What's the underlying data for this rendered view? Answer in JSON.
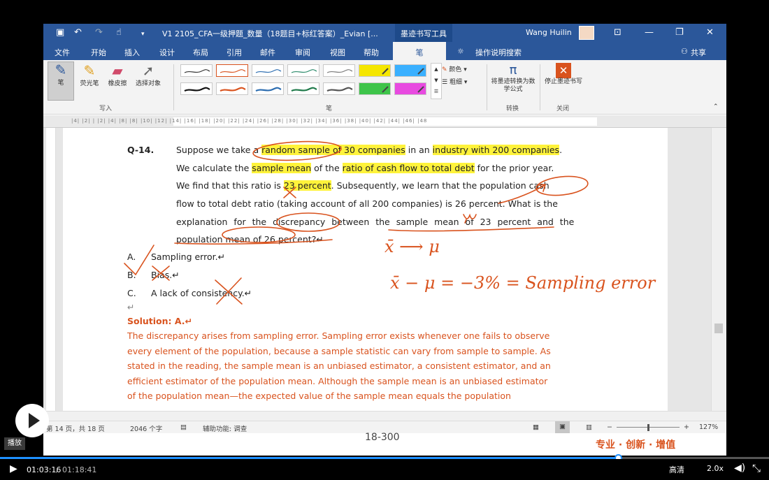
{
  "titlebar": {
    "title": "V1 2105_CFA一级押题_数量（18题目+标红答案）_Evian [...",
    "context_tab": "墨迹书写工具",
    "user": "Wang Huilin"
  },
  "menu": {
    "items": [
      "文件",
      "开始",
      "插入",
      "设计",
      "布局",
      "引用",
      "邮件",
      "审阅",
      "视图",
      "帮助",
      "笔",
      "操作说明搜索"
    ],
    "share": "共享"
  },
  "ribbon": {
    "tools": [
      "笔",
      "荧光笔",
      "橡皮擦",
      "选择对象"
    ],
    "group_write": "写入",
    "group_pens": "笔",
    "color": "颜色",
    "thickness": "粗细",
    "convert": "将墨迹转换为数学公式",
    "stop": "停止墨迹书写",
    "group_convert": "转换",
    "group_close": "关闭"
  },
  "ruler": {
    "numbers": "|4| |2| |  |2| |4| |8| |8| |10| |12| |14| |16| |18| |20| |22| |24| |26| |28| |30| |32| |34| |36| |38| |40| |42| |44| |46| |48"
  },
  "question": {
    "number": "Q-14.",
    "l1_a": "Suppose we take a ",
    "l1_b": "random sample of 30 companies",
    "l1_c": " in an ",
    "l1_d": "industry with 200 companies",
    "l1_e": ".",
    "l2_a": "We calculate the ",
    "l2_b": "sample mean",
    "l2_c": " of the ",
    "l2_d": "ratio of cash flow to total debt",
    "l2_e": " for the prior year.",
    "l3_a": "We find that this ratio is ",
    "l3_b": "23 percent",
    "l3_c": ". Subsequently, we learn that the population cash",
    "l4": "flow to total debt ratio (taking account of all 200 companies) is 26 percent. What is the",
    "l5": "explanation for the discrepancy between the sample mean of 23 percent and the",
    "l6": "population mean of 26 percent?↵"
  },
  "options": [
    {
      "letter": "A.",
      "text": "Sampling error.↵"
    },
    {
      "letter": "B.",
      "text": "Bias.↵"
    },
    {
      "letter": "C.",
      "text": "A lack of consistency.↵"
    }
  ],
  "para_mark": "↵",
  "solution": {
    "heading": "Solution: A.↵",
    "lines": [
      "The discrepancy arises from sampling error. Sampling error exists whenever one fails to observe",
      "every element of the population, because a sample statistic can vary from sample to sample. As",
      "stated in the reading, the sample mean is an unbiased estimator, a consistent estimator, and an",
      "efficient estimator of the population mean. Although the sample mean is an unbiased estimator",
      "of the population mean—the expected value of the sample mean equals the population"
    ]
  },
  "handwriting": {
    "line1": "x̄ ⟶ μ",
    "line2": "x̄ − μ = −3% = Sampling error"
  },
  "status": {
    "page": "第 14 页，共 18 页",
    "words": "2046 个字",
    "accessibility": "辅助功能: 调查",
    "zoom": "127%"
  },
  "footer": {
    "page_number": "18-300",
    "slogan": "专业 · 创新 · 增值"
  },
  "player": {
    "play_label": "播放",
    "time_current": "01:03:16",
    "time_total": "01:18:41",
    "quality": "高清",
    "speed": "2.0x",
    "progress_fraction": 0.804
  },
  "colors": {
    "ribbon_blue": "#2b579a",
    "highlight": "#fff33b",
    "ink_red": "#d9531e",
    "progress": "#1e90ff"
  }
}
